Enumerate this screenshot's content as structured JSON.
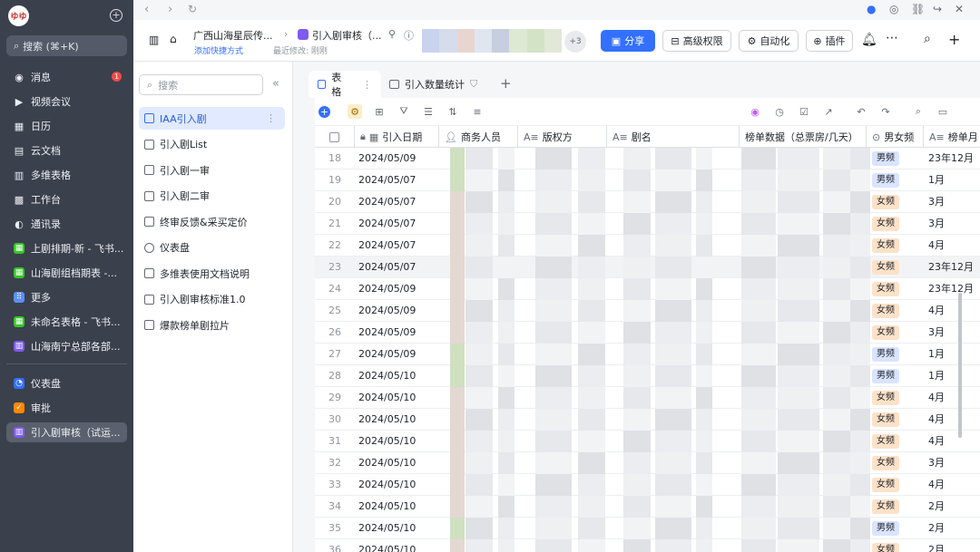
{
  "nav": {
    "avatar_text": "ゆゆ",
    "search_label": "搜索 (⌘+K)",
    "items": [
      {
        "label": "消息",
        "icon": "chat-icon",
        "color": "#eceef2",
        "badge": "1"
      },
      {
        "label": "视频会议",
        "icon": "video-icon",
        "color": "#eceef2"
      },
      {
        "label": "日历",
        "icon": "calendar-icon",
        "color": "#eceef2"
      },
      {
        "label": "云文档",
        "icon": "docs-icon",
        "color": "#eceef2"
      },
      {
        "label": "多维表格",
        "icon": "base-icon",
        "color": "#eceef2"
      },
      {
        "label": "工作台",
        "icon": "workplace-icon",
        "color": "#eceef2"
      },
      {
        "label": "通讯录",
        "icon": "contacts-icon",
        "color": "#eceef2"
      },
      {
        "label": "上剧排期-新 - 飞书...",
        "icon": "sheet-icon",
        "color": "#34c724"
      },
      {
        "label": "山海剧组档期表 -...",
        "icon": "sheet-icon",
        "color": "#34c724"
      },
      {
        "label": "更多",
        "icon": "more-apps-icon",
        "color": "#5b8ff9"
      },
      {
        "label": "未命名表格 - 飞书...",
        "icon": "sheet-icon",
        "color": "#34c724"
      },
      {
        "label": "山海南宁总部各部...",
        "icon": "base-icon",
        "color": "#7f5af0"
      },
      {
        "label": "仪表盘",
        "icon": "dashboard-icon",
        "color": "#3370ff"
      },
      {
        "label": "审批",
        "icon": "approval-icon",
        "color": "#ff8800"
      },
      {
        "label": "引入剧审核（试运...",
        "icon": "base-icon",
        "color": "#7f5af0"
      }
    ]
  },
  "header": {
    "breadcrumb_parent": "广西山海星辰传...",
    "doc_title": "引入剧审核（...",
    "add_shortcut": "添加快捷方式",
    "last_modified": "最近修改: 刚刚",
    "collaborator_count": "+3",
    "share": "分享",
    "permission": "高级权限",
    "automation": "自动化",
    "plugin": "插件"
  },
  "sidebar": {
    "search_placeholder": "搜索",
    "items": [
      {
        "label": "IAA引入剧",
        "icon": "grid-icon"
      },
      {
        "label": "引入剧List",
        "icon": "grid-icon"
      },
      {
        "label": "引入剧一审",
        "icon": "grid-icon"
      },
      {
        "label": "引入剧二审",
        "icon": "grid-icon"
      },
      {
        "label": "终审反馈&采买定价",
        "icon": "grid-icon"
      },
      {
        "label": "仪表盘",
        "icon": "dashboard-icon"
      },
      {
        "label": "多维表使用文档说明",
        "icon": "doc-icon"
      },
      {
        "label": "引入剧审核标准1.0",
        "icon": "doc-icon"
      },
      {
        "label": "爆款榜单剧拉片",
        "icon": "grid-icon"
      }
    ]
  },
  "tabs": [
    {
      "label": "表格"
    },
    {
      "label": "引入数量统计"
    }
  ],
  "columns": [
    {
      "label": "引入日期"
    },
    {
      "label": "商务人员"
    },
    {
      "label": "版权方"
    },
    {
      "label": "剧名"
    },
    {
      "label": "榜单数据（总票房/几天）"
    },
    {
      "label": "男女频"
    },
    {
      "label": "榜单月"
    }
  ],
  "rows": [
    {
      "n": "18",
      "date": "2024/05/09",
      "freq": "男频",
      "m": true,
      "rank": "23年12月"
    },
    {
      "n": "19",
      "date": "2024/05/07",
      "freq": "男频",
      "m": true,
      "rank": "1月"
    },
    {
      "n": "20",
      "date": "2024/05/07",
      "freq": "女频",
      "m": false,
      "rank": "3月"
    },
    {
      "n": "21",
      "date": "2024/05/07",
      "freq": "女频",
      "m": false,
      "rank": "3月"
    },
    {
      "n": "22",
      "date": "2024/05/07",
      "freq": "女频",
      "m": false,
      "rank": "4月"
    },
    {
      "n": "23",
      "date": "2024/05/07",
      "freq": "女频",
      "m": false,
      "rank": "23年12月"
    },
    {
      "n": "24",
      "date": "2024/05/09",
      "freq": "女频",
      "m": false,
      "rank": "23年12月"
    },
    {
      "n": "25",
      "date": "2024/05/09",
      "freq": "女频",
      "m": false,
      "rank": "4月"
    },
    {
      "n": "26",
      "date": "2024/05/09",
      "freq": "女频",
      "m": false,
      "rank": "3月"
    },
    {
      "n": "27",
      "date": "2024/05/09",
      "freq": "男频",
      "m": true,
      "rank": "1月"
    },
    {
      "n": "28",
      "date": "2024/05/10",
      "freq": "男频",
      "m": true,
      "rank": "1月"
    },
    {
      "n": "29",
      "date": "2024/05/10",
      "freq": "女频",
      "m": false,
      "rank": "4月"
    },
    {
      "n": "30",
      "date": "2024/05/10",
      "freq": "女频",
      "m": false,
      "rank": "4月"
    },
    {
      "n": "31",
      "date": "2024/05/10",
      "freq": "女频",
      "m": false,
      "rank": "4月"
    },
    {
      "n": "32",
      "date": "2024/05/10",
      "freq": "女频",
      "m": false,
      "rank": "3月"
    },
    {
      "n": "33",
      "date": "2024/05/10",
      "freq": "女频",
      "m": false,
      "rank": "4月"
    },
    {
      "n": "34",
      "date": "2024/05/10",
      "freq": "女频",
      "m": false,
      "rank": "2月"
    },
    {
      "n": "35",
      "date": "2024/05/10",
      "freq": "男频",
      "m": true,
      "rank": "2月"
    },
    {
      "n": "36",
      "date": "2024/05/10",
      "freq": "女频",
      "m": false,
      "rank": "2月"
    }
  ]
}
